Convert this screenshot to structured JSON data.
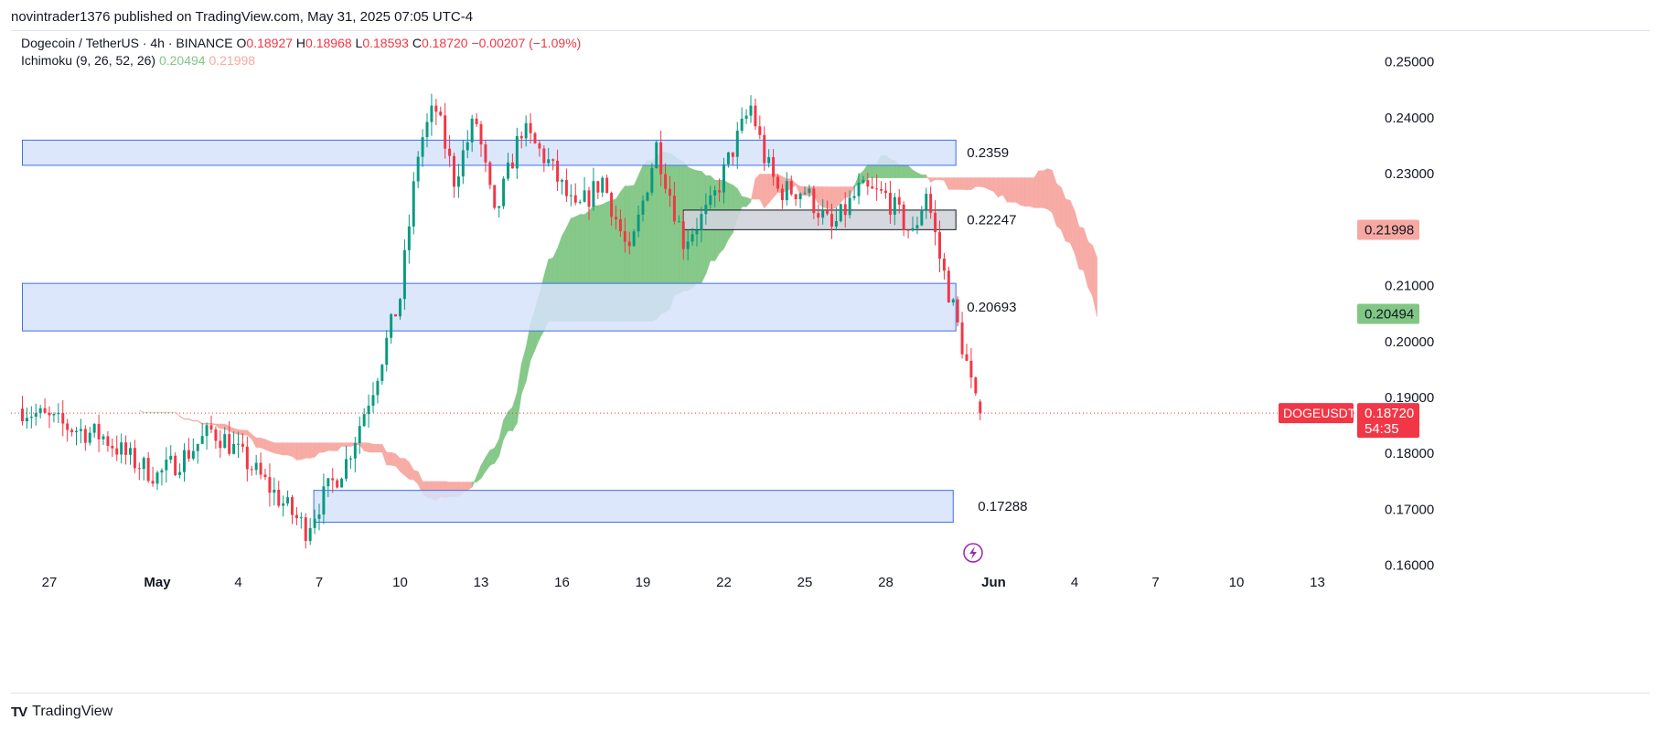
{
  "header": {
    "published": "novintrader1376 published on TradingView.com, May 31, 2025 07:05 UTC-4"
  },
  "legend": {
    "symbol": "Dogecoin / TetherUS · 4h · BINANCE",
    "o_label": "O",
    "o": "0.18927",
    "h_label": "H",
    "h": "0.18968",
    "l_label": "L",
    "l": "0.18593",
    "c_label": "C",
    "c": "0.18720",
    "change": "−0.00207 (−1.09%)",
    "indicator": "Ichimoku (9, 26, 52, 26)",
    "ind_val1": "0.20494",
    "ind_val2": "0.21998"
  },
  "footer": {
    "brand": "TradingView"
  },
  "colors": {
    "up": "#089981",
    "down": "#f23645",
    "cloud_bull": "#81c784",
    "cloud_bear": "#f7a8a2",
    "zone_fill": "#d6e3fb",
    "zone_border": "#3f6fe4",
    "grey_zone": "#d1d4dc",
    "last_price": "#f23645"
  },
  "chart_data": {
    "type": "candlestick",
    "symbol_tag": "DOGEUSDT",
    "last_price": "0.18720",
    "countdown": "54:35",
    "ylim": [
      0.1575,
      0.2555
    ],
    "y_ticks": [
      "0.25000",
      "0.24000",
      "0.23000",
      "0.21000",
      "0.20000",
      "0.19000",
      "0.18000",
      "0.17000",
      "0.16000"
    ],
    "x_ticks": [
      {
        "label": "27",
        "day": -4
      },
      {
        "label": "May",
        "day": 0
      },
      {
        "label": "4",
        "day": 3
      },
      {
        "label": "7",
        "day": 6
      },
      {
        "label": "10",
        "day": 9
      },
      {
        "label": "13",
        "day": 12
      },
      {
        "label": "16",
        "day": 15
      },
      {
        "label": "19",
        "day": 18
      },
      {
        "label": "22",
        "day": 21
      },
      {
        "label": "25",
        "day": 24
      },
      {
        "label": "28",
        "day": 27
      },
      {
        "label": "Jun",
        "day": 31
      },
      {
        "label": "4",
        "day": 34
      },
      {
        "label": "7",
        "day": 37
      },
      {
        "label": "10",
        "day": 40
      },
      {
        "label": "13",
        "day": 43
      }
    ],
    "price_badges": [
      {
        "value": "0.21998",
        "kind": "bear"
      },
      {
        "value": "0.20494",
        "kind": "bull"
      }
    ],
    "zones": [
      {
        "label": "0.2359",
        "top": 0.236,
        "bottom": 0.2315,
        "from_day": -5,
        "to_day": 29.6
      },
      {
        "label": "0.22247",
        "top": 0.2235,
        "bottom": 0.22,
        "from_day": 19.5,
        "to_day": 29.6
      },
      {
        "label": "0.20693",
        "top": 0.2104,
        "bottom": 0.2019,
        "from_day": -5,
        "to_day": 29.6
      },
      {
        "label": "0.17288",
        "top": 0.1734,
        "bottom": 0.1677,
        "from_day": 5.8,
        "to_day": 29.5
      }
    ],
    "ohlc_anchor_points": [
      {
        "day": -5,
        "close": 0.188
      },
      {
        "day": -4.5,
        "close": 0.187
      },
      {
        "day": -3.5,
        "close": 0.185
      },
      {
        "day": -2,
        "close": 0.183
      },
      {
        "day": -1,
        "close": 0.179
      },
      {
        "day": 0,
        "close": 0.176
      },
      {
        "day": 1,
        "close": 0.1795
      },
      {
        "day": 2,
        "close": 0.184
      },
      {
        "day": 2.5,
        "close": 0.1825
      },
      {
        "day": 3.5,
        "close": 0.1775
      },
      {
        "day": 4.5,
        "close": 0.172
      },
      {
        "day": 5.5,
        "close": 0.1665
      },
      {
        "day": 6,
        "close": 0.171
      },
      {
        "day": 7,
        "close": 0.1785
      },
      {
        "day": 8,
        "close": 0.192
      },
      {
        "day": 9,
        "close": 0.208
      },
      {
        "day": 9.7,
        "close": 0.235
      },
      {
        "day": 10.3,
        "close": 0.242
      },
      {
        "day": 11,
        "close": 0.229
      },
      {
        "day": 11.8,
        "close": 0.24
      },
      {
        "day": 12.5,
        "close": 0.222
      },
      {
        "day": 13.5,
        "close": 0.238
      },
      {
        "day": 14.5,
        "close": 0.232
      },
      {
        "day": 15.5,
        "close": 0.223
      },
      {
        "day": 16.5,
        "close": 0.229
      },
      {
        "day": 17.5,
        "close": 0.215
      },
      {
        "day": 18.5,
        "close": 0.235
      },
      {
        "day": 19.5,
        "close": 0.218
      },
      {
        "day": 20.5,
        "close": 0.224
      },
      {
        "day": 21.3,
        "close": 0.234
      },
      {
        "day": 22,
        "close": 0.242
      },
      {
        "day": 22.5,
        "close": 0.233
      },
      {
        "day": 23,
        "close": 0.227
      },
      {
        "day": 24,
        "close": 0.227
      },
      {
        "day": 25,
        "close": 0.22
      },
      {
        "day": 26,
        "close": 0.227
      },
      {
        "day": 27,
        "close": 0.226
      },
      {
        "day": 28,
        "close": 0.219
      },
      {
        "day": 28.5,
        "close": 0.227
      },
      {
        "day": 29,
        "close": 0.215
      },
      {
        "day": 29.5,
        "close": 0.206
      },
      {
        "day": 30,
        "close": 0.196
      },
      {
        "day": 30.3,
        "close": 0.189
      },
      {
        "day": 30.5,
        "close": 0.1872
      }
    ],
    "grid": false,
    "legend_position": "top-left"
  }
}
